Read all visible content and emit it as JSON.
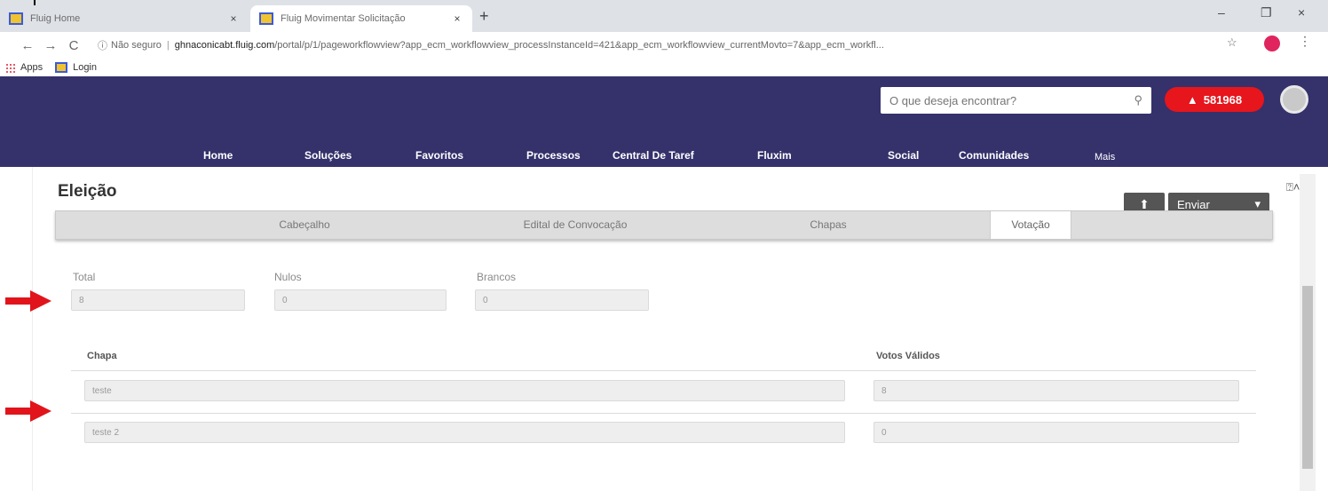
{
  "browser": {
    "tabs": [
      {
        "title": "Fluig Home",
        "close": "×"
      },
      {
        "title": "Fluig Movimentar Solicitação",
        "close": "×"
      }
    ],
    "new_tab": "+",
    "controls": {
      "minimize": "–",
      "restore": "❐",
      "close": "×"
    },
    "nav": {
      "back": "←",
      "forward": "→",
      "reload": "C"
    },
    "url": {
      "security": "Não seguro",
      "host": "ghnaconicabt.fluig.com",
      "path": "/portal/p/1/pageworkflowview?app_ecm_workflowview_processInstanceId=421&app_ecm_workflowview_currentMovto=7&app_ecm_workfl..."
    },
    "bookmarks": [
      {
        "label": "Apps"
      },
      {
        "label": "Login"
      }
    ]
  },
  "header": {
    "search_placeholder": "O que deseja encontrar?",
    "alert_count": "581968",
    "nav": [
      "Home",
      "Soluções",
      "Favoritos",
      "Processos",
      "Central De Taref",
      "Fluxim",
      "Social",
      "Comunidades",
      "Mais"
    ]
  },
  "page": {
    "title": "Eleição",
    "send_label": "Enviar",
    "tabs": [
      "Cabeçalho",
      "Edital de Convocação",
      "Chapas",
      "Votação"
    ],
    "active_tab": "Votação",
    "fields": {
      "total": {
        "label": "Total",
        "value": "8"
      },
      "nulos": {
        "label": "Nulos",
        "value": "0"
      },
      "brancos": {
        "label": "Brancos",
        "value": "0"
      }
    },
    "table": {
      "headers": [
        "Chapa",
        "Votos Válidos"
      ],
      "rows": [
        {
          "chapa": "teste",
          "votos": "8"
        },
        {
          "chapa": "teste 2",
          "votos": "0"
        }
      ]
    }
  },
  "colors": {
    "header_bg": "#34316b",
    "alert_red": "#e7151c",
    "annotation_arrow": "#e2141b"
  }
}
